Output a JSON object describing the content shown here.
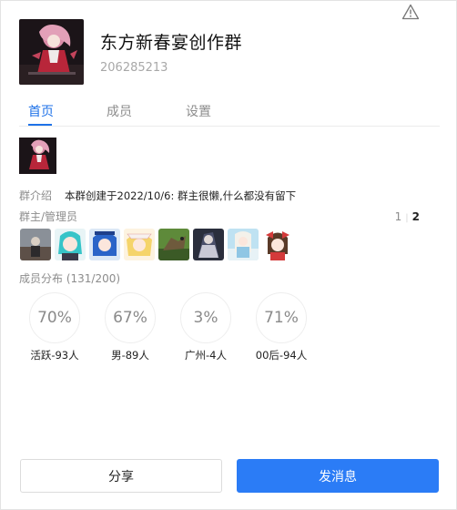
{
  "header": {
    "group_name": "东方新春宴创作群",
    "group_id": "206285213"
  },
  "tabs": [
    {
      "label": "首页",
      "active": true
    },
    {
      "label": "成员",
      "active": false
    },
    {
      "label": "设置",
      "active": false
    }
  ],
  "intro": {
    "label": "群介绍",
    "text": "本群创建于2022/10/6:  群主很懒,什么都没有留下"
  },
  "admins": {
    "label": "群主/管理员",
    "page_current": "1",
    "page_total": "2"
  },
  "distribution": {
    "label": "成员分布",
    "count": "(131/200)",
    "stats": [
      {
        "percent": "70%",
        "label": "活跃-93人"
      },
      {
        "percent": "67%",
        "label": "男-89人"
      },
      {
        "percent": "3%",
        "label": "广州-4人"
      },
      {
        "percent": "71%",
        "label": "00后-94人"
      }
    ]
  },
  "buttons": {
    "share": "分享",
    "send": "发消息"
  },
  "colors": {
    "accent": "#1f72e8",
    "primary_button": "#2b7cf6"
  },
  "icons": {
    "warning": "warning-triangle-icon"
  }
}
